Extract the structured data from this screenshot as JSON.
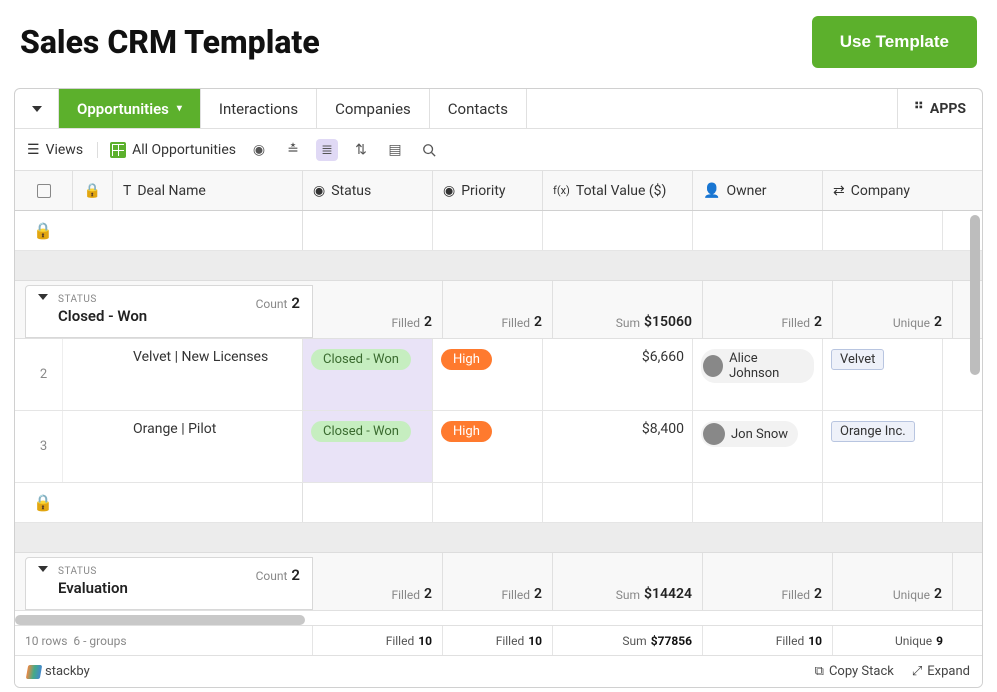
{
  "header": {
    "title": "Sales CRM Template",
    "use_template": "Use Template"
  },
  "tabs": [
    "Opportunities",
    "Interactions",
    "Companies",
    "Contacts"
  ],
  "apps_label": "APPS",
  "toolbar": {
    "views": "Views",
    "current_view": "All Opportunities"
  },
  "columns": {
    "deal_name": "Deal Name",
    "status": "Status",
    "priority": "Priority",
    "total_value": "Total Value ($)",
    "owner": "Owner",
    "company": "Company"
  },
  "group_label": "STATUS",
  "count_label": "Count",
  "filled_label": "Filled",
  "sum_label": "Sum",
  "unique_label": "Unique",
  "groups": [
    {
      "name": "Closed - Won",
      "count": "2",
      "summary": {
        "status_filled": "2",
        "priority_filled": "2",
        "sum": "$15060",
        "owner_filled": "2",
        "company_unique": "2"
      },
      "rows": [
        {
          "n": "2",
          "name": "Velvet | New Licenses",
          "status": "Closed - Won",
          "priority": "High",
          "value": "$6,660",
          "owner": "Alice Johnson",
          "company": "Velvet"
        },
        {
          "n": "3",
          "name": "Orange | Pilot",
          "status": "Closed - Won",
          "priority": "High",
          "value": "$8,400",
          "owner": "Jon Snow",
          "company": "Orange Inc."
        }
      ]
    },
    {
      "name": "Evaluation",
      "count": "2",
      "summary": {
        "status_filled": "2",
        "priority_filled": "2",
        "sum": "$14424",
        "owner_filled": "2",
        "company_unique": "2"
      },
      "rows": []
    }
  ],
  "totals": {
    "rows_label": "10 rows",
    "groups_label": "6 - groups",
    "status_filled": "10",
    "priority_filled": "10",
    "sum": "$77856",
    "owner_filled": "10",
    "company_unique": "9"
  },
  "bottombar": {
    "brand": "stackby",
    "copy": "Copy Stack",
    "expand": "Expand"
  }
}
